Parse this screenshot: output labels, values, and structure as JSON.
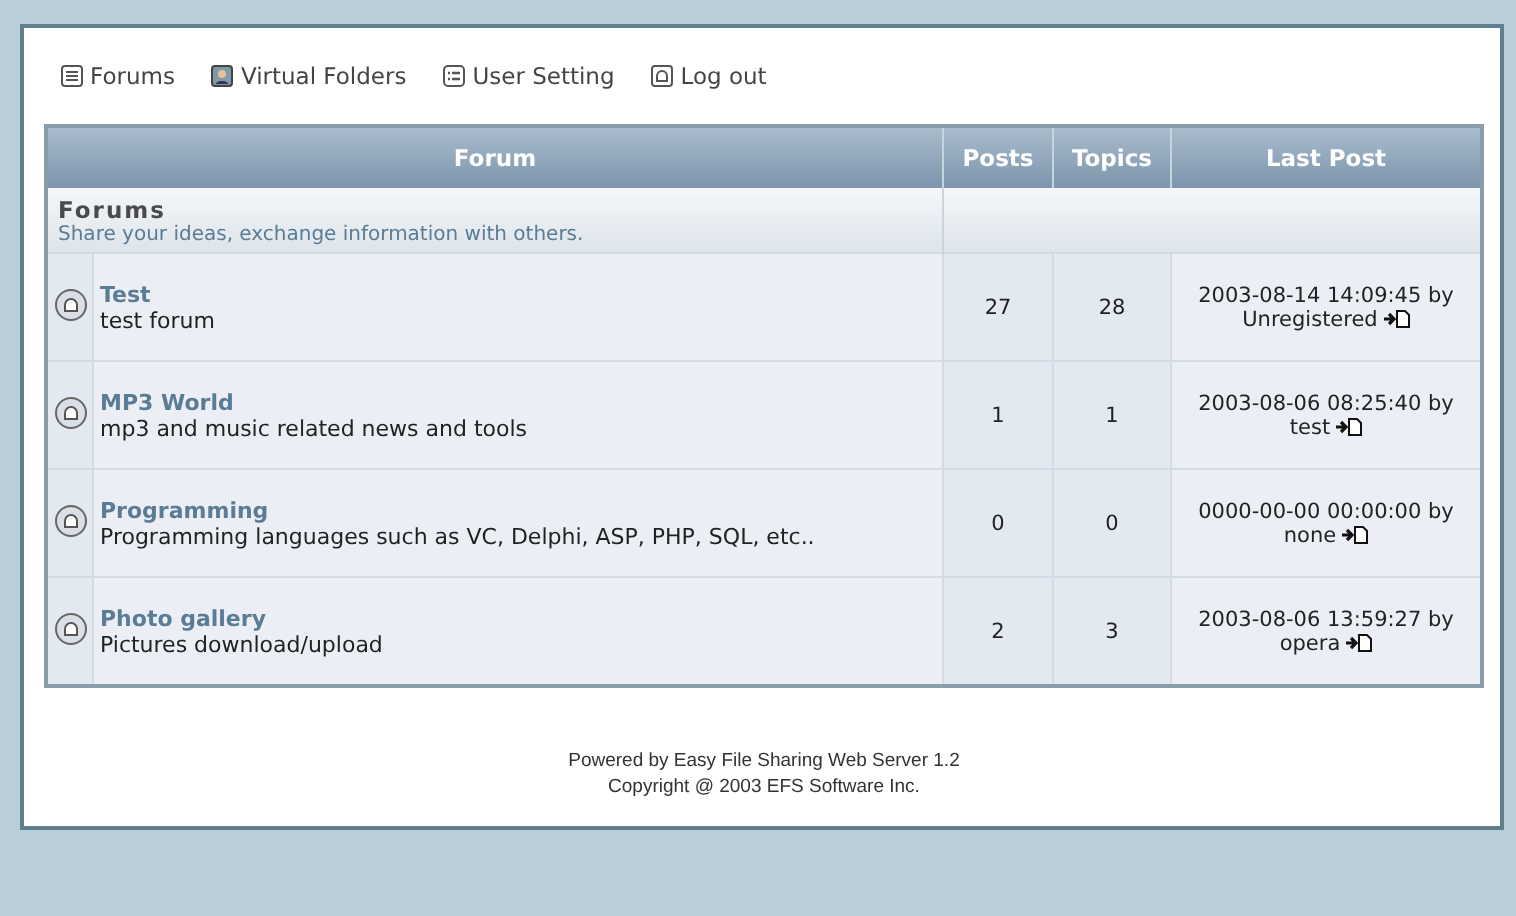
{
  "nav": [
    {
      "label": "Forums",
      "kind": "list"
    },
    {
      "label": "Virtual Folders",
      "kind": "folder"
    },
    {
      "label": "User Setting",
      "kind": "settings"
    },
    {
      "label": "Log out",
      "kind": "logout"
    }
  ],
  "table": {
    "columns": [
      "Forum",
      "Posts",
      "Topics",
      "Last Post"
    ],
    "category": {
      "title": "Forums",
      "description": "Share your ideas, exchange information with others."
    },
    "rows": [
      {
        "name": "Test",
        "description": "test forum",
        "posts": "27",
        "topics": "28",
        "last_post": "2003-08-14 14:09:45 by",
        "last_user": "Unregistered"
      },
      {
        "name": "MP3 World",
        "description": "mp3 and music related news and tools",
        "posts": "1",
        "topics": "1",
        "last_post": "2003-08-06 08:25:40 by",
        "last_user": "test"
      },
      {
        "name": "Programming",
        "description": "Programming languages such as VC, Delphi, ASP, PHP, SQL, etc..",
        "posts": "0",
        "topics": "0",
        "last_post": "0000-00-00 00:00:00 by",
        "last_user": "none"
      },
      {
        "name": "Photo gallery",
        "description": "Pictures download/upload",
        "posts": "2",
        "topics": "3",
        "last_post": "2003-08-06 13:59:27 by",
        "last_user": "opera"
      }
    ]
  },
  "footer": [
    "Powered by Easy File Sharing Web Server 1.2",
    "Copyright @ 2003 EFS Software Inc."
  ]
}
